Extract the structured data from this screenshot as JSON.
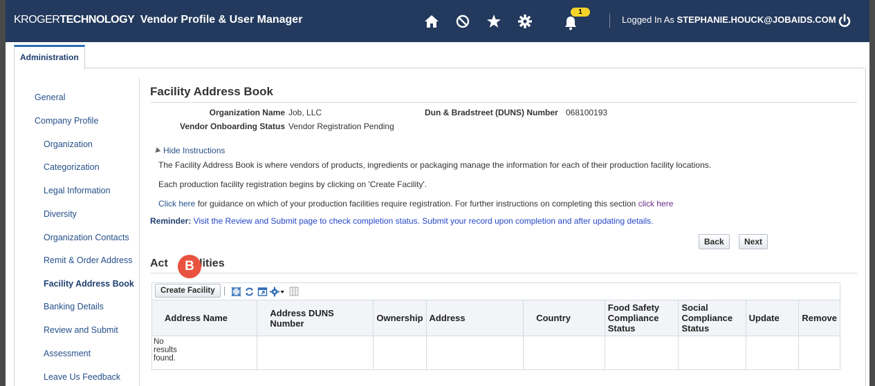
{
  "header": {
    "brand_prefix": "KROGER",
    "brand_bold": "TECHNOLOGY",
    "app_title": "Vendor Profile & User Manager",
    "notification_count": "1",
    "logged_in_prefix": "Logged In As",
    "user_email": "STEPHANIE.HOUCK@JOBAIDS.COM",
    "icons": [
      "home-icon",
      "no-entry-icon",
      "star-icon",
      "gear-icon",
      "bell-icon",
      "power-icon"
    ]
  },
  "tabs": [
    {
      "label": "Administration"
    }
  ],
  "sidebar": {
    "items": [
      {
        "label": "General"
      },
      {
        "label": "Company Profile"
      },
      {
        "label": "Organization"
      },
      {
        "label": "Categorization"
      },
      {
        "label": "Legal Information"
      },
      {
        "label": "Diversity"
      },
      {
        "label": "Organization Contacts"
      },
      {
        "label": "Remit & Order Address"
      },
      {
        "label": "Facility Address Book"
      },
      {
        "label": "Banking Details"
      },
      {
        "label": "Review and Submit"
      },
      {
        "label": "Assessment"
      },
      {
        "label": "Leave Us Feedback"
      }
    ]
  },
  "page": {
    "title": "Facility Address Book",
    "org_name_label": "Organization Name",
    "org_name_value": "Job, LLC",
    "onboarding_label": "Vendor Onboarding Status",
    "onboarding_value": "Vendor Registration Pending",
    "duns_label": "Dun & Bradstreet (DUNS) Number",
    "duns_value": "068100193",
    "hide_instructions": "Hide Instructions",
    "instr_line1": "The Facility Address Book is where vendors of products, ingredients or packaging manage the information for each of their production facility locations.",
    "instr_line2": "Each production facility registration begins by clicking on 'Create Facility'.",
    "instr_line3_link1": "Click here",
    "instr_line3_mid": " for guidance on which of your production facilities require registration. For further instructions on completing this section ",
    "instr_line3_link2": "click here",
    "reminder_label": "Reminder:",
    "reminder_text": " Visit the Review and Submit page to check completion status. Submit your record upon completion and after updating details.",
    "back_label": "Back",
    "next_label": "Next",
    "section_title_a": "Act",
    "section_title_b": "cilities",
    "step_marker": "B"
  },
  "table": {
    "create_label": "Create Facility",
    "columns": [
      "Address Name",
      "Address DUNS Number",
      "Ownership",
      "Address",
      "Country",
      "Food Safety Compliance Status",
      "Social Compliance Status",
      "Update",
      "Remove"
    ],
    "empty_message": "No results found."
  }
}
